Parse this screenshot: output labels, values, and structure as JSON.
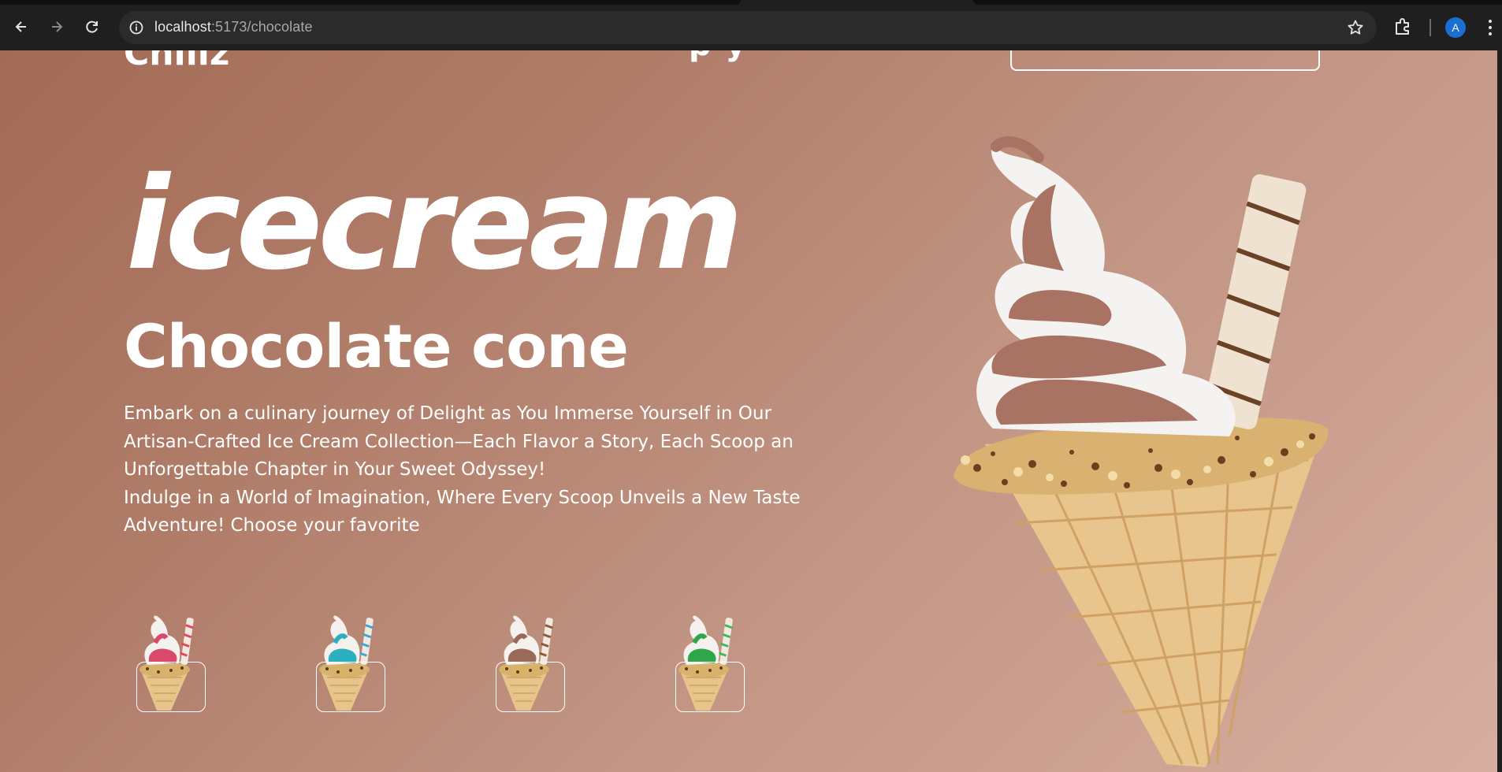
{
  "browser": {
    "url_host": "localhost",
    "url_path": ":5173/chocolate",
    "avatar_letter": "A",
    "icons": [
      "back-icon",
      "forward-icon",
      "reload-icon",
      "site-info-icon",
      "bookmark-star-icon",
      "extensions-icon",
      "kebab-menu-icon"
    ]
  },
  "header": {
    "brand": "Chillz",
    "nav_peek": "p     y"
  },
  "hero": {
    "script_title": "icecream",
    "subtitle": "Chocolate cone",
    "description_line1": "Embark on a culinary journey of Delight as You Immerse Yourself in Our Artisan-Crafted Ice Cream Collection—Each Flavor a Story, Each Scoop an Unforgettable Chapter in Your Sweet Odyssey!",
    "description_line2": "Indulge in a World of Imagination, Where Every Scoop Unveils a New Taste Adventure! Choose your favorite"
  },
  "flavors": [
    {
      "name": "strawberry",
      "swirl": "#d94a6a",
      "straw": "#e0475a"
    },
    {
      "name": "blue",
      "swirl": "#2bb0c0",
      "straw": "#39a6d8"
    },
    {
      "name": "chocolate",
      "swirl": "#9a6a58",
      "straw": "#c8a780"
    },
    {
      "name": "mint",
      "swirl": "#2fa64a",
      "straw": "#3bbb55"
    }
  ],
  "colors": {
    "bg_start": "#a36b55",
    "bg_end": "#d7aea0",
    "text": "#ffffff",
    "cone": "#e9c98e",
    "chocolate_swirl": "#a87362"
  }
}
